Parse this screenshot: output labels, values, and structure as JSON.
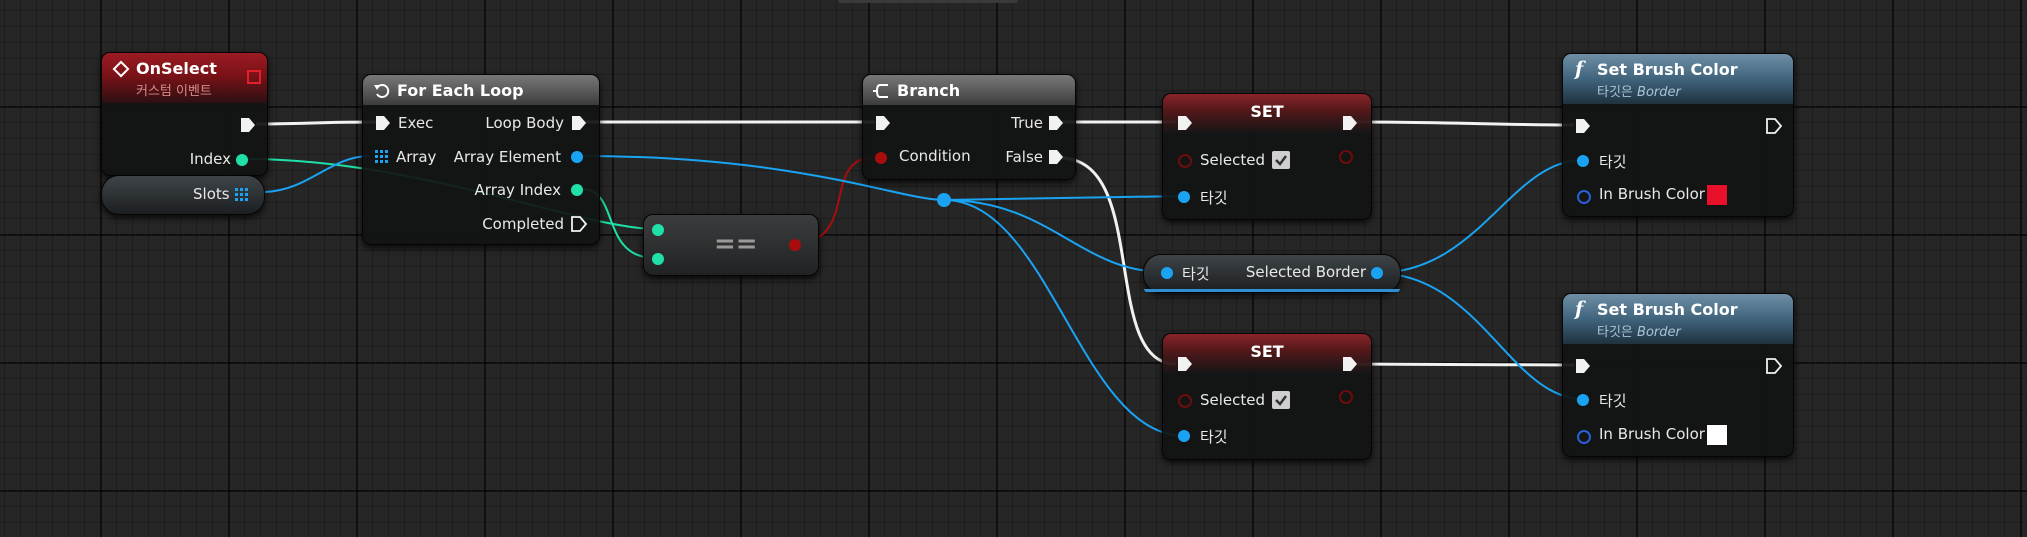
{
  "colors": {
    "exec": "#ffffff",
    "integer": "#1fe0a8",
    "object": "#1aa3f2",
    "boolean": "#a80d0d",
    "linear_color": "#2a5fd6",
    "brush_red": "#e8102a",
    "brush_white": "#ffffff"
  },
  "nodes": {
    "on_select": {
      "title": "OnSelect",
      "subtitle": "커스텀 이벤트",
      "index_label": "Index"
    },
    "slots_var": {
      "label": "Slots"
    },
    "for_each": {
      "title": "For Each Loop",
      "exec_label": "Exec",
      "array_label": "Array",
      "loop_body_label": "Loop Body",
      "array_element_label": "Array Element",
      "array_index_label": "Array Index",
      "completed_label": "Completed"
    },
    "equal": {
      "symbol": "=="
    },
    "branch": {
      "title": "Branch",
      "condition_label": "Condition",
      "true_label": "True",
      "false_label": "False"
    },
    "set_true": {
      "title": "SET",
      "selected_label": "Selected",
      "selected_checked": true,
      "target_label": "타깃"
    },
    "selected_border": {
      "target_label": "타깃",
      "output_label": "Selected Border"
    },
    "set_false": {
      "title": "SET",
      "selected_label": "Selected",
      "selected_checked": true,
      "target_label": "타깃"
    },
    "set_brush_1": {
      "title": "Set Brush Color",
      "subtitle_prefix": "타깃은",
      "subtitle_class": "Border",
      "target_label": "타깃",
      "color_label": "In Brush Color",
      "color_value": "#e8102a"
    },
    "set_brush_2": {
      "title": "Set Brush Color",
      "subtitle_prefix": "타깃은",
      "subtitle_class": "Border",
      "target_label": "타깃",
      "color_label": "In Brush Color",
      "color_value": "#ffffff"
    }
  },
  "icons": {
    "event": "event-diamond-icon",
    "loop": "loop-icon",
    "branch": "branch-icon",
    "function": "function-icon",
    "array": "array-grid-icon"
  }
}
